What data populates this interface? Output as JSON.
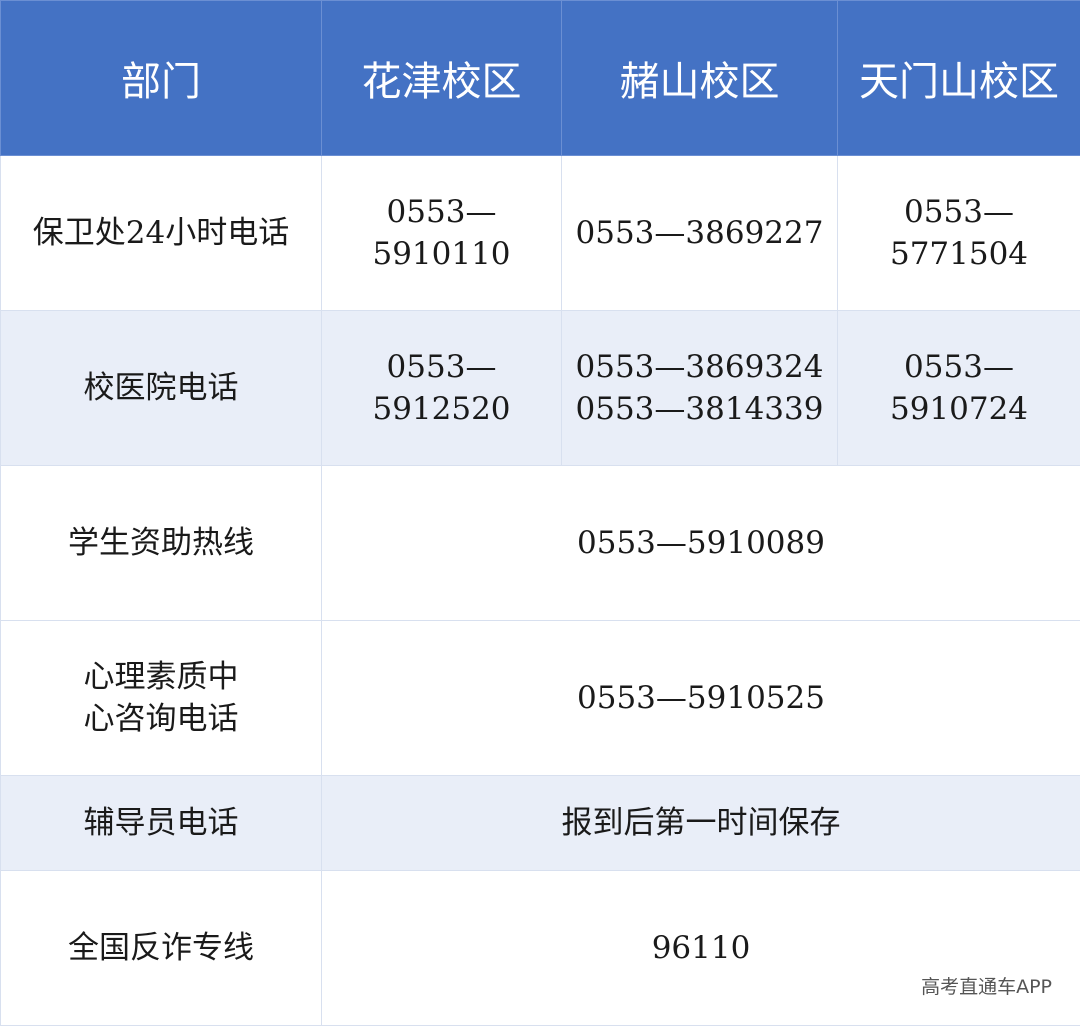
{
  "header": {
    "dept": "部门",
    "huajin": "花津校区",
    "zheshan": "赭山校区",
    "tianmenshan": "天门山校区"
  },
  "rows": [
    {
      "dept": "保卫处24小时电话",
      "huajin": "0553—5910110",
      "zheshan": "0553—3869227",
      "tianmenshan": "0553—5771504"
    },
    {
      "dept": "校医院电话",
      "huajin": "0553—5912520",
      "zheshan_line1": "0553—3869324",
      "zheshan_line2": "0553—3814339",
      "tianmenshan": "0553—5910724"
    },
    {
      "dept": "学生资助热线",
      "all": "0553—5910089"
    },
    {
      "dept_line1": "心理素质中",
      "dept_line2": "心咨询电话",
      "all": "0553—5910525"
    },
    {
      "dept": "辅导员电话",
      "all": "报到后第一时间保存"
    },
    {
      "dept": "全国反诈专线",
      "all": "96110"
    }
  ],
  "watermark": "高考直通车APP"
}
